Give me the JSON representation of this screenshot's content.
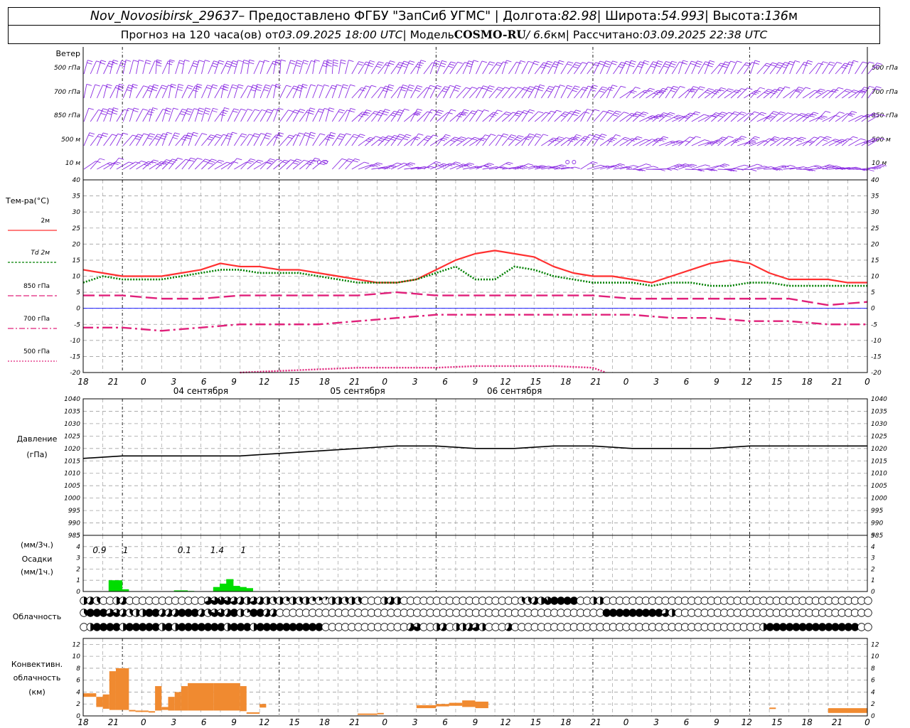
{
  "header": {
    "station": "Nov_Novosibirsk_29637",
    "provider_text": " – Предоставлено ФГБУ \"ЗапСиб УГМС\" | Долгота: ",
    "lon": "82.98",
    "lat_label": " | Широта: ",
    "lat": "54.993",
    "alt_label": " | Высота: ",
    "alt": "136",
    "alt_unit": "м",
    "forecast_text": "Прогноз на 120 часа(ов) от ",
    "start": "03.09.2025 18:00 UTC",
    "model_label": " | Модель ",
    "model": "COSMO-RU",
    "res": " / 6.6",
    "res_unit": "км",
    "calc_label": " | Рассчитано: ",
    "calc": "03.09.2025 22:38 UTC"
  },
  "colors": {
    "t2m": "#ff3030",
    "td2m": "#008000",
    "t850": "#e0207a",
    "t700": "#e0207a",
    "t500": "#e0207a",
    "wind": "#8a2be2",
    "pressure": "#000000",
    "precip": "#00dd00",
    "conv": "#f08a30",
    "zero_line": "#0000ff",
    "grid": "#a0a0a0"
  },
  "x_hour_labels": [
    "18",
    "21",
    "0",
    "3",
    "6",
    "9",
    "12",
    "15",
    "18",
    "21",
    "0",
    "3",
    "6",
    "9",
    "12",
    "15",
    "18",
    "21",
    "0",
    "3",
    "6",
    "9",
    "12",
    "15",
    "18",
    "21",
    "0"
  ],
  "date_labels": [
    "04 сентября",
    "05 сентября",
    "06 сентября"
  ],
  "chart_data": [
    {
      "type": "wind_barbs",
      "title": "Ветер",
      "levels": [
        "500 гПа",
        "700 гПа",
        "850 гПа",
        "500 м",
        "10 м"
      ],
      "x_hours": [
        0,
        120
      ],
      "note": "barbs every hour; directions shown by shaft orientation"
    },
    {
      "type": "line",
      "title": "Тем-ра(°C)",
      "ylim": [
        -20,
        40
      ],
      "yticks": [
        -20,
        -15,
        -10,
        -5,
        0,
        5,
        10,
        15,
        20,
        25,
        30,
        35,
        40
      ],
      "series": [
        {
          "name": "2м",
          "x": [
            0,
            3,
            6,
            9,
            12,
            15,
            18,
            21,
            24,
            27,
            30,
            33,
            36,
            39,
            42,
            45,
            48,
            51,
            54,
            57,
            60,
            63,
            66,
            69,
            72,
            75,
            78,
            81,
            84,
            87,
            90,
            93,
            96,
            99,
            102,
            105,
            108,
            111,
            114,
            117,
            120
          ],
          "values": [
            12,
            11,
            10,
            10,
            10,
            11,
            12,
            14,
            13,
            13,
            12,
            12,
            11,
            10,
            9,
            8,
            8,
            9,
            12,
            15,
            17,
            18,
            17,
            16,
            13,
            11,
            10,
            10,
            9,
            8,
            10,
            12,
            14,
            15,
            14,
            11,
            9,
            9,
            9,
            8,
            8
          ]
        },
        {
          "name": "Td 2м",
          "x": [
            0,
            3,
            6,
            9,
            12,
            15,
            18,
            21,
            24,
            27,
            30,
            33,
            36,
            39,
            42,
            45,
            48,
            51,
            54,
            57,
            60,
            63,
            66,
            69,
            72,
            75,
            78,
            81,
            84,
            87,
            90,
            93,
            96,
            99,
            102,
            105,
            108,
            111,
            114,
            117,
            120
          ],
          "values": [
            8,
            10,
            9,
            9,
            9,
            10,
            11,
            12,
            12,
            11,
            11,
            11,
            10,
            9,
            8,
            8,
            8,
            9,
            11,
            13,
            9,
            9,
            13,
            12,
            10,
            9,
            8,
            8,
            8,
            7,
            8,
            8,
            7,
            7,
            8,
            8,
            7,
            7,
            7,
            7,
            7
          ]
        },
        {
          "name": "850 гПа",
          "x": [
            0,
            6,
            12,
            18,
            24,
            30,
            36,
            42,
            48,
            54,
            60,
            66,
            72,
            78,
            84,
            90,
            96,
            102,
            108,
            114,
            120
          ],
          "values": [
            4,
            4,
            3,
            3,
            4,
            4,
            4,
            4,
            5,
            4,
            4,
            4,
            4,
            4,
            3,
            3,
            3,
            3,
            3,
            1,
            2
          ]
        },
        {
          "name": "700 гПа",
          "x": [
            0,
            6,
            12,
            18,
            24,
            30,
            36,
            42,
            48,
            54,
            60,
            66,
            72,
            78,
            84,
            90,
            96,
            102,
            108,
            114,
            120
          ],
          "values": [
            -6,
            -6,
            -7,
            -6,
            -5,
            -5,
            -5,
            -4,
            -3,
            -2,
            -2,
            -2,
            -2,
            -2,
            -2,
            -3,
            -3,
            -4,
            -4,
            -5,
            -5
          ]
        },
        {
          "name": "500 гПа",
          "x": [
            24,
            30,
            36,
            42,
            48,
            54,
            60,
            66,
            72,
            78,
            80
          ],
          "values": [
            -20,
            -19.5,
            -19,
            -18.5,
            -18.5,
            -18.5,
            -18,
            -18,
            -18,
            -18.5,
            -20
          ]
        }
      ]
    },
    {
      "type": "line",
      "title": "Давление",
      "ylabel": "(гПа)",
      "ylim": [
        985,
        1040
      ],
      "yticks": [
        985,
        990,
        995,
        1000,
        1005,
        1010,
        1015,
        1020,
        1025,
        1030,
        1035,
        1040
      ],
      "series": [
        {
          "name": "",
          "x": [
            0,
            6,
            12,
            18,
            24,
            30,
            36,
            42,
            48,
            54,
            60,
            66,
            72,
            78,
            84,
            90,
            96,
            102,
            108,
            114,
            120
          ],
          "values": [
            1016,
            1017,
            1017,
            1017,
            1017,
            1018,
            1019,
            1020,
            1021,
            1021,
            1020,
            1020,
            1021,
            1021,
            1020,
            1020,
            1020,
            1021,
            1021,
            1021,
            1021
          ]
        }
      ]
    },
    {
      "type": "bar",
      "title": "Осадки",
      "ylabel_top": "(мм/3ч.)",
      "ylabel_bottom": "(мм/1ч.)",
      "ylim": [
        0,
        5
      ],
      "yticks": [
        0,
        1,
        2,
        3,
        4,
        5
      ],
      "hourly_x": [
        3,
        4,
        5,
        6,
        14,
        15,
        16,
        20,
        21,
        22,
        23,
        24,
        25
      ],
      "hourly_values": [
        0,
        1,
        1,
        0.2,
        0.1,
        0.1,
        0.05,
        0.4,
        0.7,
        1.1,
        0.5,
        0.4,
        0.3
      ],
      "sum3h_labels": [
        {
          "x": 2.5,
          "label": "0.9"
        },
        {
          "x": 6.5,
          "label": "1"
        },
        {
          "x": 15.5,
          "label": "0.1"
        },
        {
          "x": 20.5,
          "label": "1.4"
        },
        {
          "x": 24.5,
          "label": "1"
        }
      ]
    },
    {
      "type": "table",
      "title": "Облачность",
      "rows": 3,
      "note": "cloud cover circles per hour for three layers"
    },
    {
      "type": "bar",
      "title": "Конвективн. облачность",
      "ylabel": "(км)",
      "ylim": [
        0,
        13
      ],
      "yticks": [
        0,
        2,
        4,
        6,
        8,
        10,
        12
      ],
      "bars": [
        {
          "x0": 0,
          "x1": 2,
          "bottom": 3.2,
          "top": 3.8
        },
        {
          "x0": 2,
          "x1": 3,
          "bottom": 1.5,
          "top": 3.2
        },
        {
          "x0": 3,
          "x1": 4,
          "bottom": 1.2,
          "top": 3.6
        },
        {
          "x0": 4,
          "x1": 5,
          "bottom": 1.0,
          "top": 7.5
        },
        {
          "x0": 5,
          "x1": 7,
          "bottom": 1.0,
          "top": 8.0
        },
        {
          "x0": 7,
          "x1": 8,
          "bottom": 1.0,
          "top": 1.0
        },
        {
          "x0": 8,
          "x1": 10,
          "bottom": 0.7,
          "top": 0.9
        },
        {
          "x0": 10,
          "x1": 11,
          "bottom": 0.8,
          "top": 0.8
        },
        {
          "x0": 11,
          "x1": 12,
          "bottom": 0.9,
          "top": 5.0
        },
        {
          "x0": 12,
          "x1": 13,
          "bottom": 1.0,
          "top": 1.5
        },
        {
          "x0": 13,
          "x1": 14,
          "bottom": 0.9,
          "top": 3.2
        },
        {
          "x0": 14,
          "x1": 15,
          "bottom": 0.9,
          "top": 4.0
        },
        {
          "x0": 15,
          "x1": 16,
          "bottom": 0.9,
          "top": 5.0
        },
        {
          "x0": 16,
          "x1": 20,
          "bottom": 0.9,
          "top": 5.5
        },
        {
          "x0": 20,
          "x1": 24,
          "bottom": 0.9,
          "top": 5.5
        },
        {
          "x0": 24,
          "x1": 25,
          "bottom": 0.8,
          "top": 5.0
        },
        {
          "x0": 25,
          "x1": 27,
          "bottom": 0.5,
          "top": 0.6
        },
        {
          "x0": 27,
          "x1": 28,
          "bottom": 1.4,
          "top": 2.0
        },
        {
          "x0": 42,
          "x1": 45,
          "bottom": 0.3,
          "top": 0.4
        },
        {
          "x0": 45,
          "x1": 46,
          "bottom": 0.3,
          "top": 0.5
        },
        {
          "x0": 51,
          "x1": 54,
          "bottom": 1.3,
          "top": 1.8
        },
        {
          "x0": 54,
          "x1": 56,
          "bottom": 1.6,
          "top": 2.0
        },
        {
          "x0": 56,
          "x1": 58,
          "bottom": 1.7,
          "top": 2.2
        },
        {
          "x0": 58,
          "x1": 60,
          "bottom": 1.5,
          "top": 2.6
        },
        {
          "x0": 60,
          "x1": 62,
          "bottom": 1.3,
          "top": 2.4
        },
        {
          "x0": 105,
          "x1": 106,
          "bottom": 1.2,
          "top": 1.4
        },
        {
          "x0": 114,
          "x1": 120,
          "bottom": 0.5,
          "top": 1.3
        }
      ]
    }
  ]
}
